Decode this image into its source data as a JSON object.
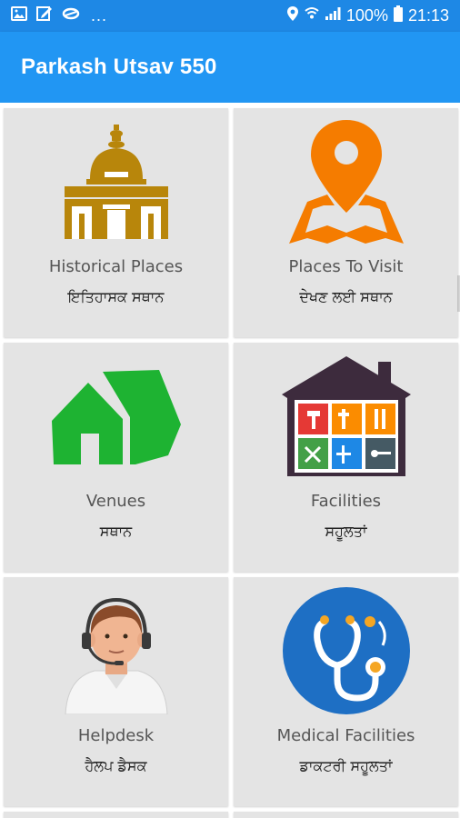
{
  "status_bar": {
    "more": "...",
    "battery": "100%",
    "time": "21:13"
  },
  "app_bar": {
    "title": "Parkash Utsav 550"
  },
  "tiles": [
    {
      "icon": "historical-building-icon",
      "label_en": "Historical Places",
      "label_pa": "ਇਤਿਹਾਸਕ ਸਥਾਨ",
      "color": "#b8860b"
    },
    {
      "icon": "map-location-pin-icon",
      "label_en": "Places To Visit",
      "label_pa": "ਦੇਖਣ ਲਈ ਸਥਾਨ",
      "color": "#f57c00"
    },
    {
      "icon": "venue-tent-icon",
      "label_en": "Venues",
      "label_pa": "ਸਥਾਨ",
      "color": "#1eb332"
    },
    {
      "icon": "facilities-house-icon",
      "label_en": "Facilities",
      "label_pa": "ਸਹੂਲਤਾਂ",
      "color": "#3a2a3a"
    },
    {
      "icon": "helpdesk-operator-icon",
      "label_en": "Helpdesk",
      "label_pa": "ਹੈਲਪ ਡੈਸਕ",
      "color": "#5a3a2a"
    },
    {
      "icon": "stethoscope-icon",
      "label_en": "Medical Facilities",
      "label_pa": "ਡਾਕਟਰੀ ਸਹੂਲਤਾਂ",
      "color": "#1e88e5"
    }
  ]
}
